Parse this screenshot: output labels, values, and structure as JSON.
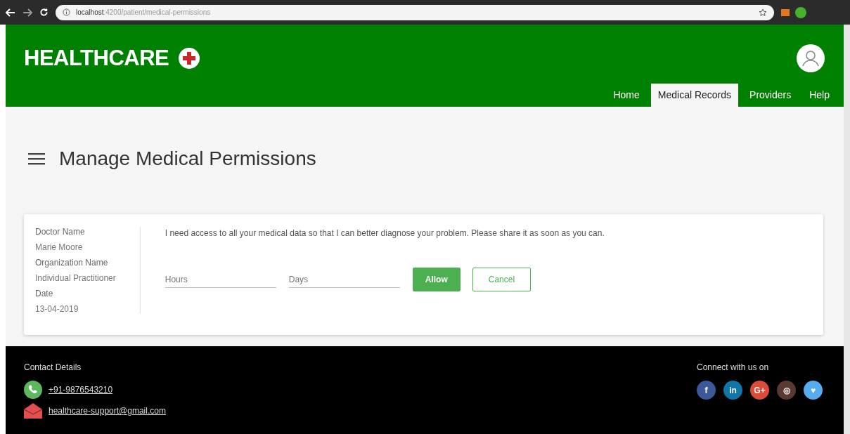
{
  "browser": {
    "url_host": "localhost",
    "url_path": ":4200/patient/medical-permissions"
  },
  "header": {
    "brand": "HEALTHCARE",
    "nav": [
      {
        "label": "Home",
        "selected": false
      },
      {
        "label": "Medical Records",
        "selected": true
      },
      {
        "label": "Providers",
        "selected": false
      },
      {
        "label": "Help",
        "selected": false
      }
    ]
  },
  "page": {
    "title": "Manage Medical Permissions"
  },
  "request": {
    "details": [
      {
        "label": "Doctor Name",
        "value": "Marie Moore"
      },
      {
        "label": "Organization Name",
        "value": "Individual Practitioner"
      },
      {
        "label": "Date",
        "value": "13-04-2019"
      }
    ],
    "message": "I need access to all your medical data so that I can better diagnose your problem. Please share it as soon as you can.",
    "fields": [
      {
        "placeholder": "Hours"
      },
      {
        "placeholder": "Days"
      }
    ],
    "buttons": [
      {
        "label": "Allow",
        "kind": "primary"
      },
      {
        "label": "Cancel",
        "kind": "outline"
      }
    ]
  },
  "footer": {
    "contact_title": "Contact Details",
    "contacts": [
      {
        "kind": "phone",
        "text": "+91-9876543210"
      },
      {
        "kind": "email",
        "text": "healthcare-support@gmail.com"
      }
    ],
    "social_title": "Connect with us on",
    "social": [
      {
        "glyph": "f",
        "color": "#3b5998"
      },
      {
        "glyph": "in",
        "color": "#0e76a8"
      },
      {
        "glyph": "G+",
        "color": "#dd4b39"
      },
      {
        "glyph": "◎",
        "color": "#5a3a30"
      },
      {
        "glyph": "♥",
        "color": "#55acee"
      }
    ]
  }
}
